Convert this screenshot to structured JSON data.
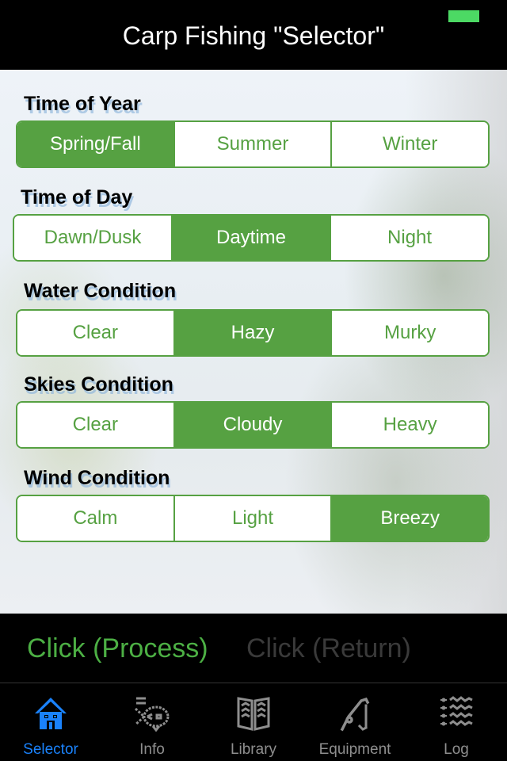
{
  "status_bar": {
    "battery_color": "#4cd964"
  },
  "nav": {
    "title": "Carp Fishing \"Selector\""
  },
  "accent_color": "#56a142",
  "sections": [
    {
      "label": "Time of Year",
      "options": [
        "Spring/Fall",
        "Summer",
        "Winter"
      ],
      "selected": "Spring/Fall"
    },
    {
      "label": "Time of Day",
      "options": [
        "Dawn/Dusk",
        "Daytime",
        "Night"
      ],
      "selected": "Daytime"
    },
    {
      "label": "Water Condition",
      "options": [
        "Clear",
        "Hazy",
        "Murky"
      ],
      "selected": "Hazy"
    },
    {
      "label": "Skies Condition",
      "options": [
        "Clear",
        "Cloudy",
        "Heavy"
      ],
      "selected": "Cloudy"
    },
    {
      "label": "Wind Condition",
      "options": [
        "Calm",
        "Light",
        "Breezy"
      ],
      "selected": "Breezy"
    }
  ],
  "actions": {
    "process": "Click (Process)",
    "return": "Click (Return)"
  },
  "tabs": [
    {
      "label": "Selector",
      "icon": "house-icon",
      "active": true
    },
    {
      "label": "Info",
      "icon": "fish-icon",
      "active": false
    },
    {
      "label": "Library",
      "icon": "book-icon",
      "active": false
    },
    {
      "label": "Equipment",
      "icon": "fishing-rod-icon",
      "active": false
    },
    {
      "label": "Log",
      "icon": "log-list-icon",
      "active": false
    }
  ]
}
